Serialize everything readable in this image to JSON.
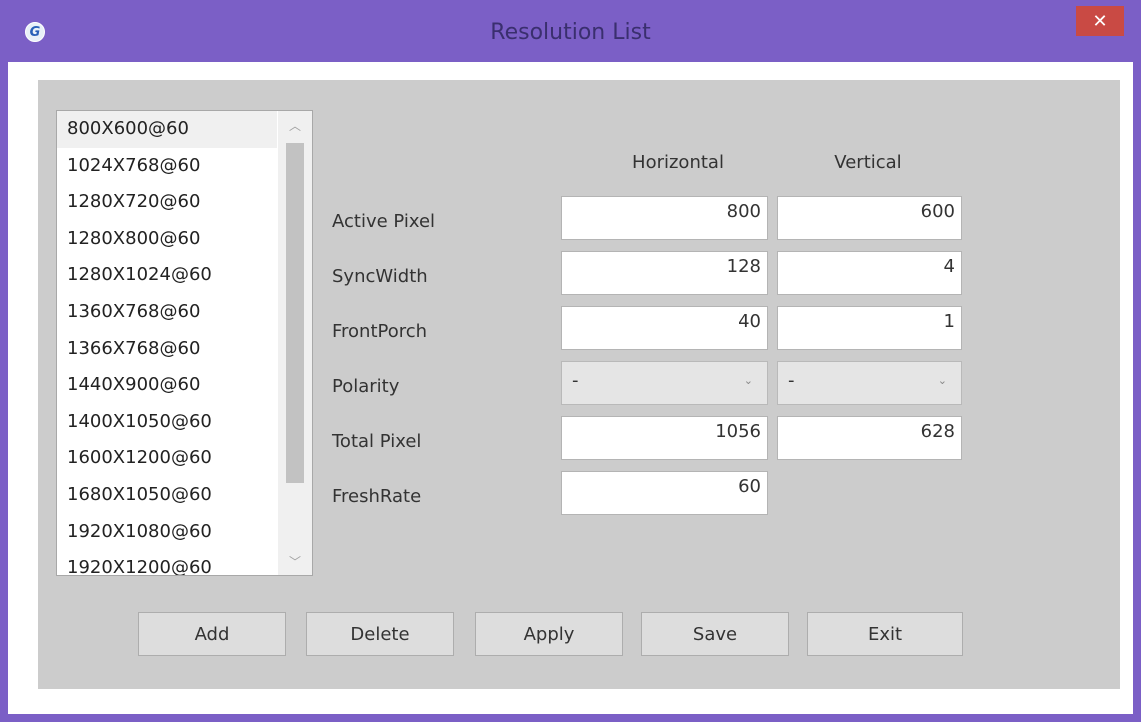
{
  "window": {
    "title": "Resolution List",
    "app_icon_letter": "G",
    "close_glyph": "✕",
    "accent_color": "#7b5fc6",
    "close_color": "#c94a44"
  },
  "resolution_list": {
    "items": [
      {
        "label": "800X600@60",
        "selected": true
      },
      {
        "label": "1024X768@60",
        "selected": false
      },
      {
        "label": "1280X720@60",
        "selected": false
      },
      {
        "label": "1280X800@60",
        "selected": false
      },
      {
        "label": "1280X1024@60",
        "selected": false
      },
      {
        "label": "1360X768@60",
        "selected": false
      },
      {
        "label": "1366X768@60",
        "selected": false
      },
      {
        "label": "1440X900@60",
        "selected": false
      },
      {
        "label": "1400X1050@60",
        "selected": false
      },
      {
        "label": "1600X1200@60",
        "selected": false
      },
      {
        "label": "1680X1050@60",
        "selected": false
      },
      {
        "label": "1920X1080@60",
        "selected": false
      },
      {
        "label": "1920X1200@60",
        "selected": false
      }
    ],
    "scroll_up_glyph": "︿",
    "scroll_down_glyph": "﹀"
  },
  "timing": {
    "col_horizontal": "Horizontal",
    "col_vertical": "Vertical",
    "active_pixel": {
      "label": "Active Pixel",
      "horizontal": "800",
      "vertical": "600"
    },
    "sync_width": {
      "label": "SyncWidth",
      "horizontal": "128",
      "vertical": "4"
    },
    "front_porch": {
      "label": "FrontPorch",
      "horizontal": "40",
      "vertical": "1"
    },
    "polarity": {
      "label": "Polarity",
      "horizontal": "-",
      "vertical": "-",
      "arrow_glyph": "⌄"
    },
    "total_pixel": {
      "label": "Total Pixel",
      "horizontal": "1056",
      "vertical": "628"
    },
    "fresh_rate": {
      "label": "FreshRate",
      "value": "60"
    }
  },
  "buttons": {
    "add": "Add",
    "delete": "Delete",
    "apply": "Apply",
    "save": "Save",
    "exit": "Exit"
  }
}
